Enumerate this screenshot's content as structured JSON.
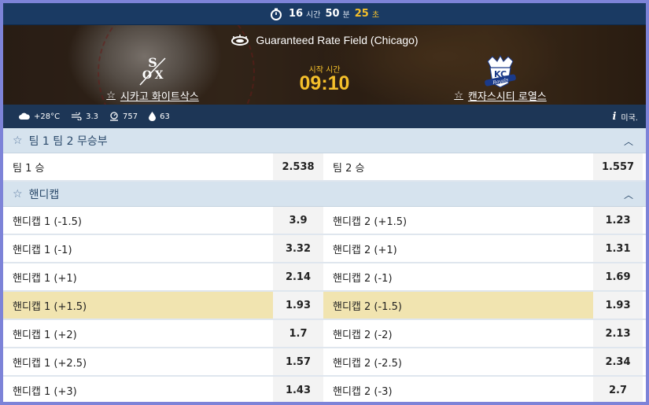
{
  "timer": {
    "hours": "16",
    "hours_unit": "시간",
    "minutes": "50",
    "minutes_unit": "분",
    "seconds": "25",
    "seconds_unit": "초"
  },
  "match": {
    "venue": "Guaranteed Rate Field (Chicago)",
    "start_label": "시작 시간",
    "start_time": "09:10",
    "home_team": "시카고 화이트삭스",
    "away_team": "캔자스시티 로열스"
  },
  "weather": {
    "temperature": "+28°C",
    "wind": "3.3",
    "pressure": "757",
    "humidity": "63",
    "info_label": "미국."
  },
  "sections": [
    {
      "title": "팀 1 팀 2 무승부",
      "rows": [
        {
          "left": "팀 1 승",
          "left_odd": "2.538",
          "right": "팀 2 승",
          "right_odd": "1.557"
        }
      ]
    },
    {
      "title": "핸디캡",
      "rows": [
        {
          "left": "핸디캡 1 (-1.5)",
          "left_odd": "3.9",
          "right": "핸디캡 2 (+1.5)",
          "right_odd": "1.23"
        },
        {
          "left": "핸디캡 1 (-1)",
          "left_odd": "3.32",
          "right": "핸디캡 2 (+1)",
          "right_odd": "1.31"
        },
        {
          "left": "핸디캡 1 (+1)",
          "left_odd": "2.14",
          "right": "핸디캡 2 (-1)",
          "right_odd": "1.69"
        },
        {
          "left": "핸디캡 1 (+1.5)",
          "left_odd": "1.93",
          "right": "핸디캡 2 (-1.5)",
          "right_odd": "1.93"
        },
        {
          "left": "핸디캡 1 (+2)",
          "left_odd": "1.7",
          "right": "핸디캡 2 (-2)",
          "right_odd": "2.13"
        },
        {
          "left": "핸디캡 1 (+2.5)",
          "left_odd": "1.57",
          "right": "핸디캡 2 (-2.5)",
          "right_odd": "2.34"
        },
        {
          "left": "핸디캡 1 (+3)",
          "left_odd": "1.43",
          "right": "핸디캡 2 (-3)",
          "right_odd": "2.7"
        }
      ]
    }
  ],
  "colors": {
    "accent": "#f5c02b",
    "header_bg": "#1a3a63",
    "section_bg": "#d6e3ee",
    "highlight_row": "#f1e4b0"
  },
  "icons": {
    "timer": "stopwatch-icon",
    "venue": "stadium-icon",
    "favorite": "star-outline-icon",
    "collapse": "chevron-up-icon",
    "weather": [
      "cloud-icon",
      "wind-icon",
      "pressure-icon",
      "humidity-icon",
      "info-icon"
    ]
  }
}
